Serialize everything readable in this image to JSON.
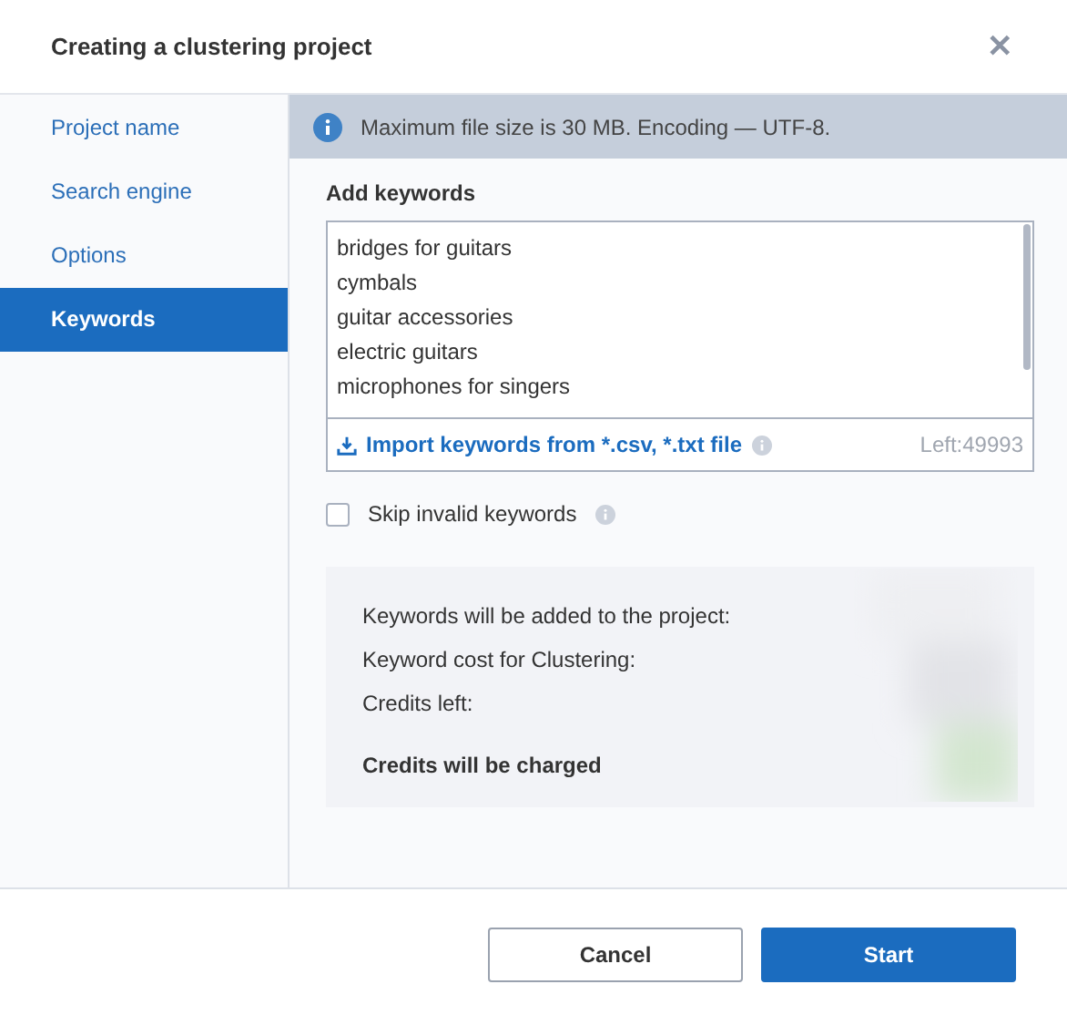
{
  "window": {
    "title": "Creating a clustering project",
    "close": "✕"
  },
  "sidebar": {
    "items": [
      {
        "label": "Project name",
        "selected": false
      },
      {
        "label": "Search engine",
        "selected": false
      },
      {
        "label": "Options",
        "selected": false
      },
      {
        "label": "Keywords",
        "selected": true
      }
    ]
  },
  "info_bar": {
    "text": "Maximum file size is 30 MB. Encoding — UTF-8."
  },
  "keywords": {
    "label": "Add keywords",
    "lines": [
      "bridges for guitars",
      "cymbals",
      "guitar accessories",
      "electric guitars",
      "microphones for singers"
    ],
    "import_link": "Import keywords from *.csv, *.txt file",
    "left": "Left:49993"
  },
  "skip_invalid": {
    "label": "Skip invalid keywords",
    "checked": false
  },
  "summary": {
    "rows": [
      "Keywords will be added to the project:",
      "Keyword cost for Clustering:",
      "Credits left:"
    ],
    "total": "Credits will be charged"
  },
  "buttons": [
    {
      "label": "Cancel",
      "kind": "secondary"
    },
    {
      "label": "Start",
      "kind": "primary"
    }
  ]
}
